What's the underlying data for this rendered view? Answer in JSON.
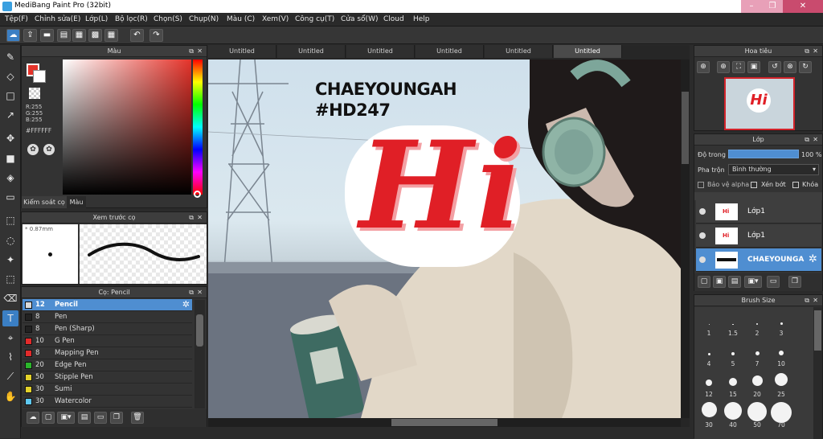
{
  "app": {
    "title": "MediBang Paint Pro (32bit)",
    "window_controls": [
      "–",
      "❐",
      "✕"
    ]
  },
  "menu": [
    "Tệp(F)",
    "Chỉnh sửa(E)",
    "Lớp(L)",
    "Bộ lọc(R)",
    "Chọn(S)",
    "Chụp(N)",
    "Màu (C)",
    "Xem(V)",
    "Công cụ(T)",
    "Cửa sổ(W)",
    "Cloud",
    "Help"
  ],
  "color_panel": {
    "title": "Màu",
    "rgb": [
      "R:255",
      "G:255",
      "B:255"
    ],
    "hex": "#FFFFFF",
    "tabs": [
      "Kiểm soát cọ",
      "Màu"
    ],
    "fg_color": "#e5332a",
    "bg_color": "#ffffff"
  },
  "brush_preview": {
    "title": "Xem trước cọ",
    "size": "0.87mm"
  },
  "brush_panel": {
    "title": "Cọ: Pencil",
    "brushes": [
      {
        "size": "12",
        "name": "Pencil",
        "color": "#d9d9d9",
        "selected": true
      },
      {
        "size": "8",
        "name": "Pen",
        "color": "#222222"
      },
      {
        "size": "8",
        "name": "Pen (Sharp)",
        "color": "#222222"
      },
      {
        "size": "10",
        "name": "G Pen",
        "color": "#e22b2b"
      },
      {
        "size": "8",
        "name": "Mapping Pen",
        "color": "#e22b2b"
      },
      {
        "size": "20",
        "name": "Edge Pen",
        "color": "#2bb52b"
      },
      {
        "size": "50",
        "name": "Stipple Pen",
        "color": "#e3d12a"
      },
      {
        "size": "30",
        "name": "Sumi",
        "color": "#e3d12a"
      },
      {
        "size": "30",
        "name": "Watercolor",
        "color": "#5ec8f0"
      }
    ]
  },
  "tabs": [
    "Untitled",
    "Untitled",
    "Untitled",
    "Untitled",
    "Untitled",
    "Untitled"
  ],
  "artwork": {
    "line1": "CHAEYOUNGAH",
    "line2": "#HD247",
    "hi_text": "Hi"
  },
  "navigator": {
    "title": "Hoa tiêu"
  },
  "layer_panel": {
    "title": "Lớp",
    "opacity_label": "Độ trong",
    "opacity_value": "100 %",
    "blend_label": "Pha trộn",
    "blend_value": "Bình thường",
    "options": [
      "Bảo vệ alpha",
      "Xén bớt",
      "Khóa"
    ],
    "layers": [
      {
        "name": "Lớp1",
        "selected": false
      },
      {
        "name": "Lớp1",
        "selected": false
      },
      {
        "name": "CHAEYOUNGA",
        "selected": true
      }
    ]
  },
  "brush_size_panel": {
    "title": "Brush Size",
    "sizes": [
      "1",
      "1.5",
      "2",
      "3",
      "4",
      "5",
      "7",
      "10",
      "12",
      "15",
      "20",
      "25",
      "30",
      "40",
      "50",
      "70"
    ]
  },
  "colors": {
    "accent": "#4f8ed1",
    "panel_bg": "#333333",
    "hi_red": "#e01f26"
  }
}
